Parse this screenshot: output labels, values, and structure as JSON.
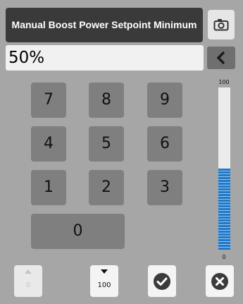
{
  "header": {
    "title": "Manual Boost Power Setpoint Minimum",
    "icon": "camera-icon"
  },
  "entry": {
    "value": "50%",
    "backspace_icon": "chevron-left-icon"
  },
  "keypad": {
    "k7": "7",
    "k8": "8",
    "k9": "9",
    "k4": "4",
    "k5": "5",
    "k6": "6",
    "k1": "1",
    "k2": "2",
    "k3": "3",
    "k0": "0"
  },
  "slider": {
    "max_label": "100",
    "min_label": "0",
    "level": 0.5,
    "fill_color": "#1f78c8"
  },
  "footer": {
    "min_button_label": "0",
    "max_button_label": "100",
    "ok_icon": "check-circle-icon",
    "cancel_icon": "close-circle-icon"
  }
}
